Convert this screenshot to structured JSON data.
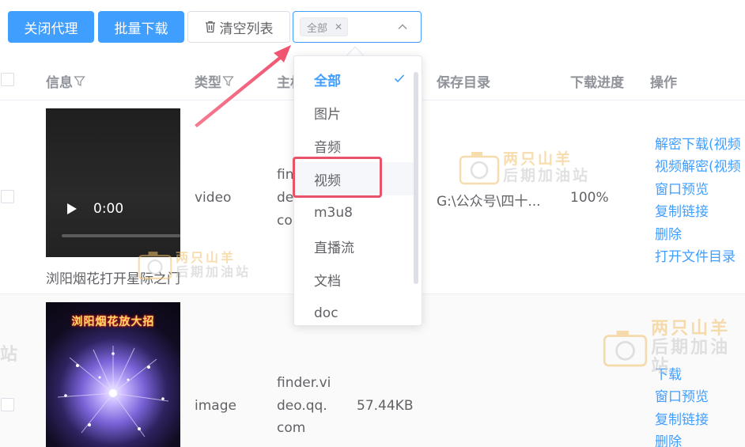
{
  "toolbar": {
    "close_proxy": "关闭代理",
    "batch_download": "批量下载",
    "clear_list": "清空列表"
  },
  "filter_select": {
    "selected_tag": "全部"
  },
  "table": {
    "headers": {
      "info": "信息",
      "type": "类型",
      "host": "主机",
      "save_dir": "保存目录",
      "progress": "下载进度",
      "actions": "操作"
    },
    "rows": [
      {
        "video_time": "0:00",
        "caption": "浏阳烟花打开星际之门",
        "type": "video",
        "host_lines": [
          "fin",
          "de",
          "co"
        ],
        "save_dir": "G:\\公众号\\四十...",
        "progress": "100%",
        "actions": [
          "解密下载(视频",
          "视频解密(视频",
          "窗口预览",
          "复制链接",
          "删除",
          "打开文件目录"
        ]
      },
      {
        "thumb_title": "浏阳烟花放大招",
        "type": "image",
        "host_lines": [
          "finder.vi",
          "deo.qq.",
          "com"
        ],
        "size": "57.44KB",
        "actions": [
          "下载",
          "窗口预览",
          "复制链接",
          "删除"
        ]
      }
    ]
  },
  "dropdown": {
    "options": [
      {
        "label": "全部",
        "selected": true
      },
      {
        "label": "图片"
      },
      {
        "label": "音频"
      },
      {
        "label": "视频",
        "hovered": true
      },
      {
        "label": "m3u8"
      },
      {
        "label": "直播流"
      },
      {
        "label": "文档"
      },
      {
        "label": "doc"
      }
    ]
  },
  "watermark": {
    "line1": "两只山羊",
    "line2": "后期加油站",
    "edge_fragment": "站"
  },
  "colors": {
    "primary": "#409eff",
    "highlight_red": "#e8536a",
    "arrow_red": "#f0506e"
  }
}
